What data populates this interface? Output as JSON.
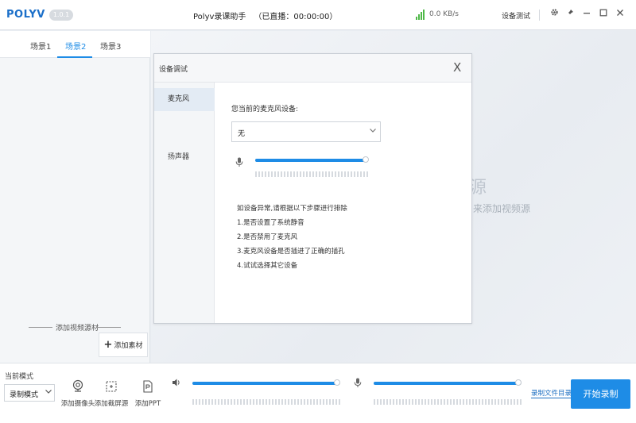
{
  "titlebar": {
    "logo": "POLYV",
    "version": "1.0.1",
    "title": "Polyv录课助手",
    "live_status": "（已直播：00:00:00）",
    "net_speed": "0.0 KB/s",
    "device_test": "设备测试"
  },
  "scene_tabs": [
    {
      "label": "场景1",
      "active": false
    },
    {
      "label": "场景2",
      "active": true
    },
    {
      "label": "场景3",
      "active": false
    }
  ],
  "left_panel": {
    "add_video_source": "添加视频源材",
    "add_material": "添加素材"
  },
  "preview": {
    "big_char": "源",
    "hint": "来添加视频源"
  },
  "dialog": {
    "title": "设备调试",
    "close": "X",
    "side_items": [
      {
        "label": "麦克风",
        "active": true
      },
      {
        "label": "扬声器",
        "active": false
      }
    ],
    "current_device_label": "您当前的麦克风设备:",
    "device_value": "无",
    "volume_level": 0.98,
    "help_lines": [
      "如设备异常,请根据以下步骤进行排除",
      "1.是否设置了系统静音",
      "2.是否禁用了麦克风",
      "3.麦克风设备是否插进了正确的插孔",
      "4.试试选择其它设备"
    ]
  },
  "bottom": {
    "mode_label": "当前模式",
    "mode_value": "录制模式",
    "tools": [
      {
        "label": "添加摄像头",
        "icon": "camera-icon"
      },
      {
        "label": "添加截屏源",
        "icon": "screenshot-icon"
      },
      {
        "label": "添加PPT",
        "icon": "ppt-icon"
      }
    ],
    "speaker_level": 0.98,
    "mic_level": 0.98,
    "folder_link": "录制文件目录",
    "start_button": "开始录制"
  },
  "colors": {
    "accent": "#1e8ce6",
    "signal": "#4fb848"
  }
}
